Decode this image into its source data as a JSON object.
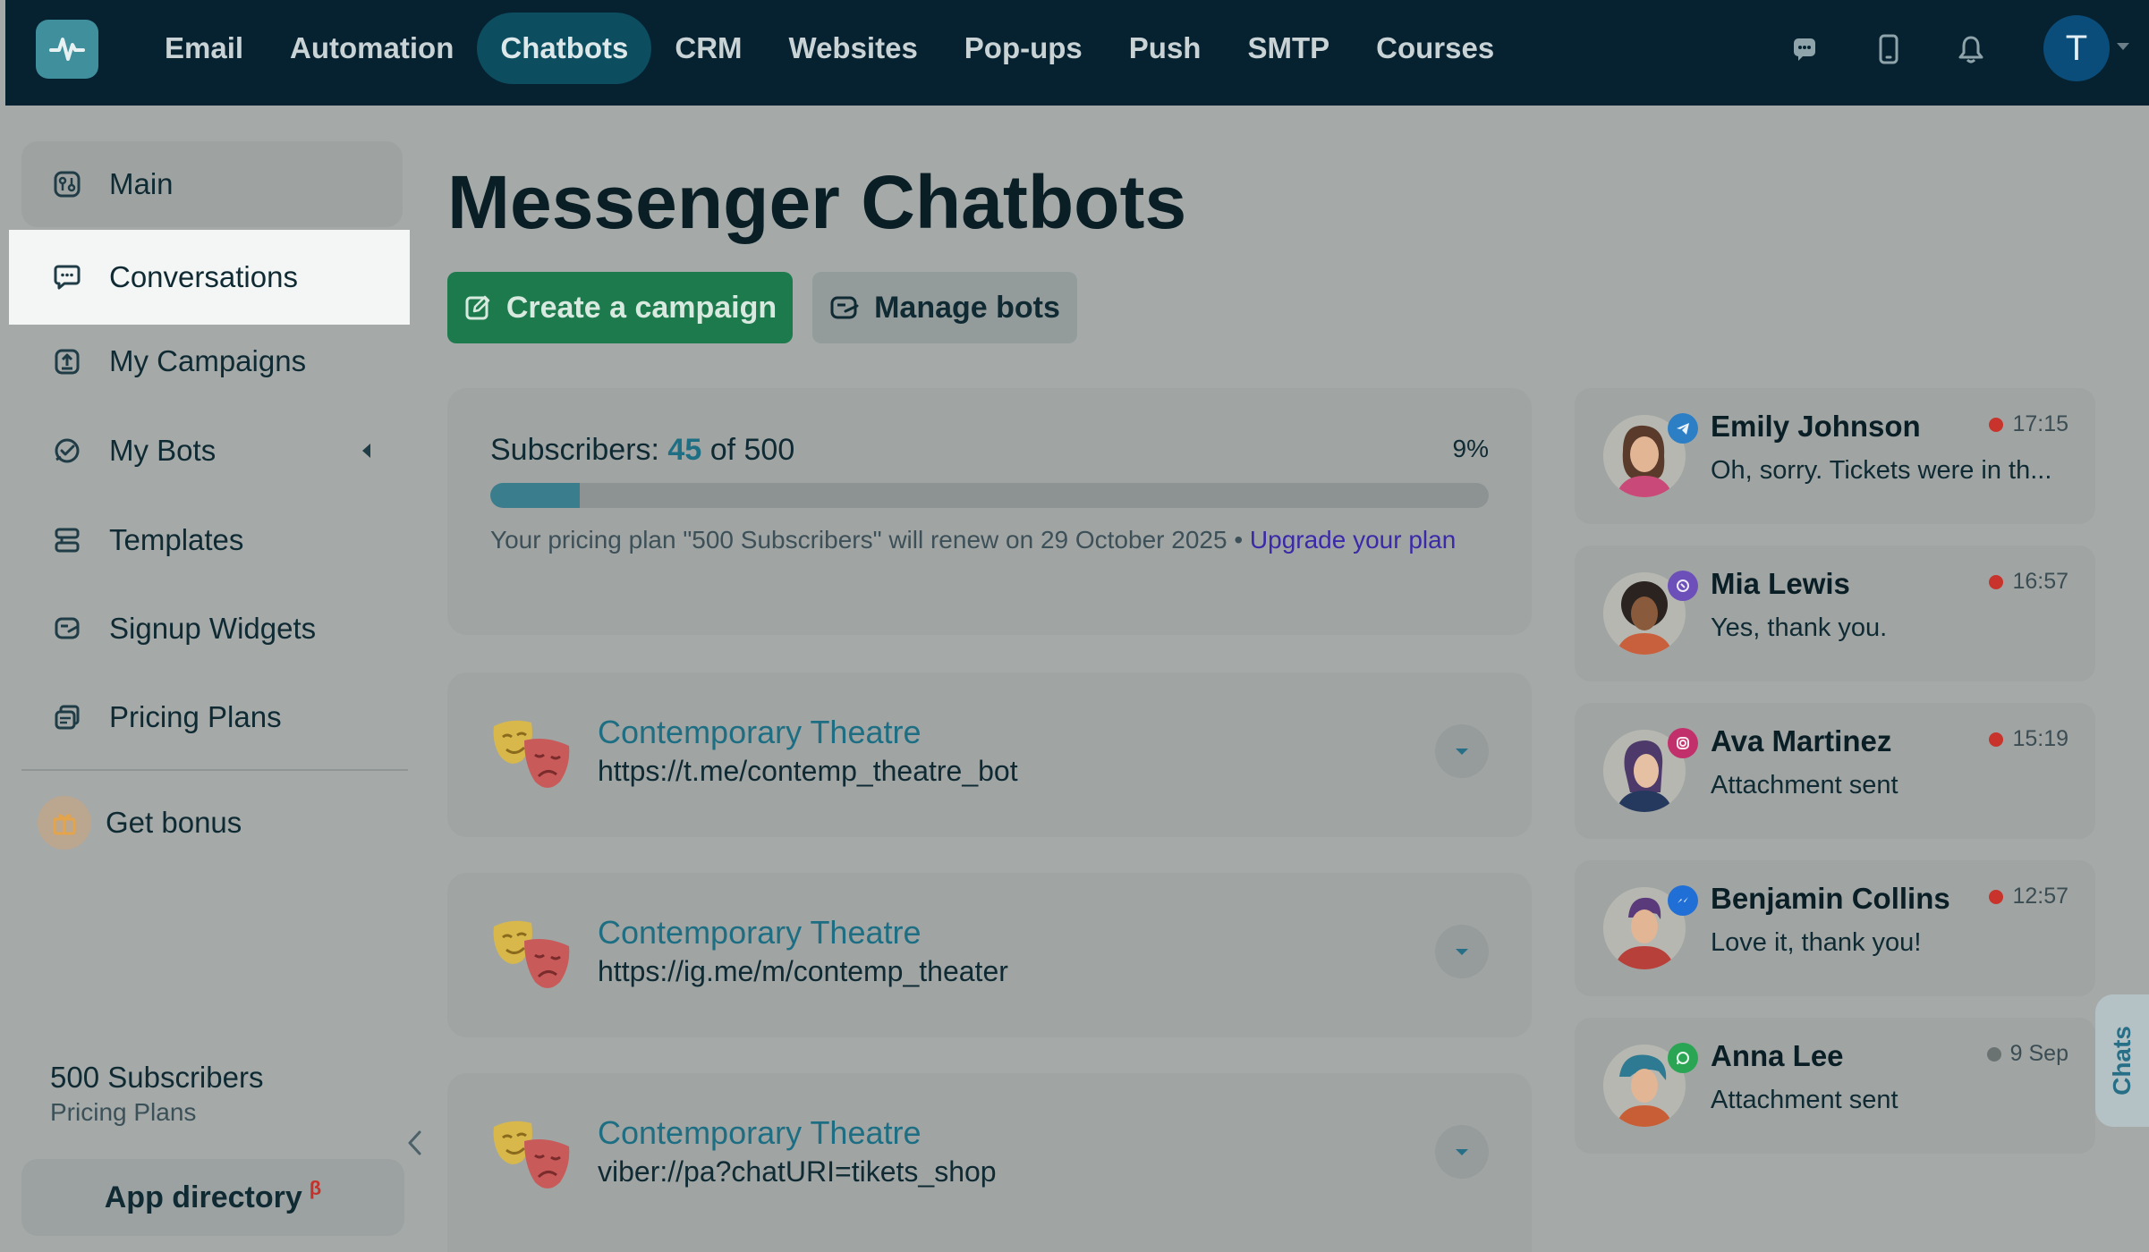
{
  "nav": {
    "items": [
      {
        "label": "Email"
      },
      {
        "label": "Automation"
      },
      {
        "label": "Chatbots",
        "active": true
      },
      {
        "label": "CRM"
      },
      {
        "label": "Websites"
      },
      {
        "label": "Pop-ups"
      },
      {
        "label": "Push"
      },
      {
        "label": "SMTP"
      },
      {
        "label": "Courses"
      }
    ],
    "avatar_initial": "T"
  },
  "sidebar": {
    "items": [
      {
        "label": "Main",
        "icon": "dashboard-icon"
      },
      {
        "label": "Conversations",
        "icon": "chat-bubble-icon",
        "active": true
      },
      {
        "label": "My Campaigns",
        "icon": "upload-icon"
      },
      {
        "label": "My Bots",
        "icon": "bot-icon"
      },
      {
        "label": "Templates",
        "icon": "templates-icon"
      },
      {
        "label": "Signup Widgets",
        "icon": "widget-icon"
      },
      {
        "label": "Pricing Plans",
        "icon": "pricing-icon"
      }
    ],
    "bonus": "Get bonus",
    "plan_name": "500 Subscribers",
    "plan_sub": "Pricing Plans",
    "app_directory": "App directory",
    "app_directory_badge": "β"
  },
  "main": {
    "title": "Messenger Chatbots",
    "create_button": "Create a campaign",
    "manage_button": "Manage bots",
    "subscribers": {
      "label": "Subscribers:",
      "count": "45",
      "of": "of 500",
      "percent": "9%",
      "progress": 0.09,
      "renew_text": "Your pricing plan \"500 Subscribers\" will renew on 29 October 2025 • ",
      "upgrade_link": "Upgrade your plan"
    },
    "bots": [
      {
        "name": "Contemporary Theatre",
        "link": "https://t.me/contemp_theatre_bot"
      },
      {
        "name": "Contemporary Theatre",
        "link": "https://ig.me/m/contemp_theater"
      },
      {
        "name": "Contemporary Theatre",
        "link": "viber://pa?chatURI=tikets_shop"
      }
    ]
  },
  "chats": {
    "tab_label": "Chats",
    "items": [
      {
        "name": "Emily Johnson",
        "message": "Oh, sorry. Tickets were in th...",
        "time": "17:15",
        "channel": "telegram-icon",
        "channel_color": "#2c7fc4",
        "unread": true
      },
      {
        "name": "Mia Lewis",
        "message": "Yes, thank you.",
        "time": "16:57",
        "channel": "viber-icon",
        "channel_color": "#6c4fb8",
        "unread": true
      },
      {
        "name": "Ava Martinez",
        "message": "Attachment sent",
        "time": "15:19",
        "channel": "instagram-icon",
        "channel_color": "#c2306c",
        "unread": true
      },
      {
        "name": "Benjamin Collins",
        "message": "Love it, thank you!",
        "time": "12:57",
        "channel": "messenger-icon",
        "channel_color": "#1f6fd6",
        "unread": true
      },
      {
        "name": "Anna Lee",
        "message": "Attachment sent",
        "time": "9 Sep",
        "channel": "whatsapp-icon",
        "channel_color": "#2aa553",
        "unread": false
      }
    ]
  }
}
